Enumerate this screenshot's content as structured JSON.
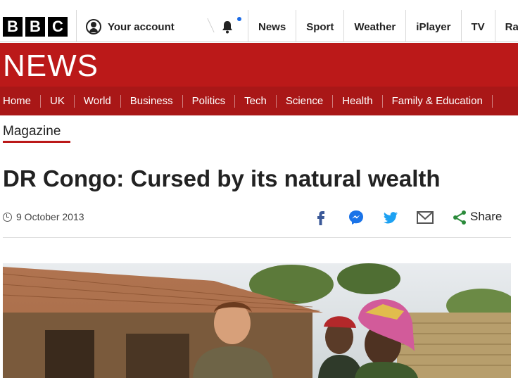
{
  "topbar": {
    "logo_letters": [
      "B",
      "B",
      "C"
    ],
    "account_label": "Your account",
    "account_icon": "user-circle-icon",
    "notification_icon": "bell-icon",
    "notification_dot_color": "#1a6ae6",
    "nav": [
      "News",
      "Sport",
      "Weather",
      "iPlayer",
      "TV",
      "Radi"
    ]
  },
  "banner": {
    "title": "NEWS",
    "color": "#bb1919"
  },
  "section_nav": [
    "Home",
    "UK",
    "World",
    "Business",
    "Politics",
    "Tech",
    "Science",
    "Health",
    "Family & Education"
  ],
  "article": {
    "section": "Magazine",
    "headline": "DR Congo: Cursed by its natural wealth",
    "date": "9 October 2013",
    "share_label": "Share",
    "share_icons": [
      "facebook-icon",
      "messenger-icon",
      "twitter-icon",
      "email-icon",
      "share-icon"
    ]
  },
  "colors": {
    "accent_red": "#bb1919",
    "facebook_blue": "#3b5998",
    "twitter_blue": "#1da1f2",
    "share_green": "#2a8a3a"
  }
}
